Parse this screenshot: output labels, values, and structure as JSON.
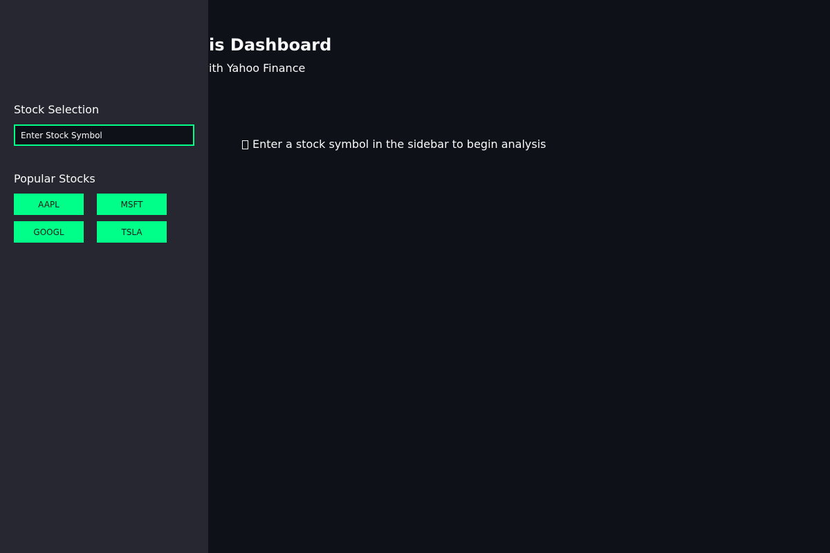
{
  "header": {
    "title": "📈 Stock Analysis Dashboard",
    "subtitle": "Real-time stock analysis with Yahoo Finance"
  },
  "main": {
    "info_message": "Enter a stock symbol in the sidebar to begin analysis",
    "info_icon": "missing-glyph-icon"
  },
  "sidebar": {
    "stock_selection_label": "Stock Selection",
    "symbol_input": {
      "value": "",
      "placeholder": "Enter Stock Symbol"
    },
    "popular_label": "Popular Stocks",
    "popular_stocks": [
      "AAPL",
      "MSFT",
      "GOOGL",
      "TSLA"
    ]
  },
  "colors": {
    "accent": "#00ff88",
    "background": "#0e1118",
    "sidebar_background": "#262730",
    "text": "#fafafa"
  }
}
